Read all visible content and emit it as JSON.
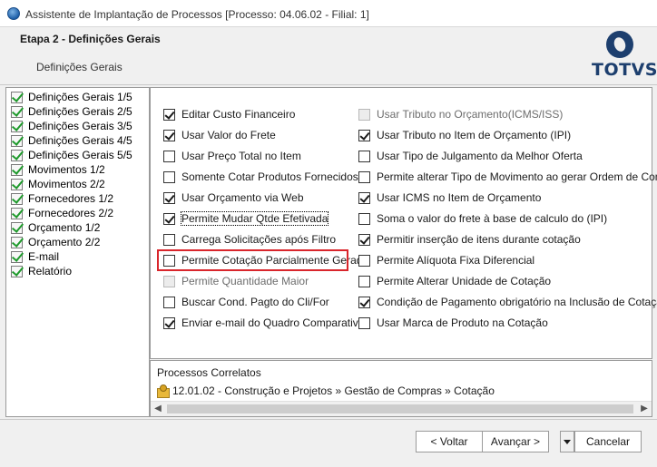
{
  "window": {
    "title": "Assistente de Implantação de Processos [Processo: 04.06.02 - Filial: 1]"
  },
  "header": {
    "step_title": "Etapa 2 - Definições Gerais",
    "step_subtitle": "Definições Gerais",
    "logo_text": "TOTVS",
    "logo_color": "#1d3f6e"
  },
  "sidebar": {
    "items": [
      {
        "label": "Definições Gerais 1/5",
        "icon": "green-check-icon"
      },
      {
        "label": "Definições Gerais 2/5",
        "icon": "green-check-icon"
      },
      {
        "label": "Definições Gerais 3/5",
        "icon": "green-check-icon"
      },
      {
        "label": "Definições Gerais 4/5",
        "icon": "green-check-icon"
      },
      {
        "label": "Definições Gerais 5/5",
        "icon": "green-check-icon"
      },
      {
        "label": "Movimentos 1/2",
        "icon": "green-check-icon"
      },
      {
        "label": "Movimentos 2/2",
        "icon": "green-check-icon"
      },
      {
        "label": "Fornecedores 1/2",
        "icon": "green-check-icon"
      },
      {
        "label": "Fornecedores 2/2",
        "icon": "green-check-icon"
      },
      {
        "label": "Orçamento 1/2",
        "icon": "green-check-icon"
      },
      {
        "label": "Orçamento 2/2",
        "icon": "green-check-icon"
      },
      {
        "label": "E-mail",
        "icon": "green-check-icon"
      },
      {
        "label": "Relatório",
        "icon": "green-check-icon"
      }
    ]
  },
  "options": {
    "left": [
      {
        "label": "Editar Custo Financeiro",
        "checked": true,
        "enabled": true
      },
      {
        "label": "Usar Valor do Frete",
        "checked": true,
        "enabled": true
      },
      {
        "label": "Usar  Preço Total no Item",
        "checked": false,
        "enabled": true
      },
      {
        "label": "Somente Cotar Produtos Fornecidos",
        "checked": false,
        "enabled": true
      },
      {
        "label": "Usar Orçamento via Web",
        "checked": true,
        "enabled": true
      },
      {
        "label": "Permite Mudar Qtde Efetivada",
        "checked": true,
        "enabled": true
      },
      {
        "label": "Carrega Solicitações após Filtro",
        "checked": false,
        "enabled": true
      },
      {
        "label": "Permite Cotação Parcialmente Gerada",
        "checked": false,
        "enabled": true
      },
      {
        "label": "Permite Quantidade Maior",
        "checked": false,
        "enabled": false
      },
      {
        "label": "Buscar Cond. Pagto do Cli/For",
        "checked": false,
        "enabled": true
      },
      {
        "label": "Enviar e-mail do Quadro Comparativo",
        "checked": true,
        "enabled": true
      }
    ],
    "right": [
      {
        "label": "Usar Tributo no Orçamento(ICMS/ISS)",
        "checked": false,
        "enabled": false
      },
      {
        "label": "Usar Tributo no Item de Orçamento (IPI)",
        "checked": true,
        "enabled": true
      },
      {
        "label": "Usar Tipo de Julgamento da Melhor Oferta",
        "checked": false,
        "enabled": true
      },
      {
        "label": "Permite alterar Tipo de Movimento ao gerar Ordem de Compra",
        "checked": false,
        "enabled": true
      },
      {
        "label": "Usar ICMS no Item de Orçamento",
        "checked": true,
        "enabled": true
      },
      {
        "label": "Soma o valor do frete à base de calculo do (IPI)",
        "checked": false,
        "enabled": true
      },
      {
        "label": "Permitir inserção de itens durante cotação",
        "checked": true,
        "enabled": true
      },
      {
        "label": "Permite Alíquota Fixa Diferencial",
        "checked": false,
        "enabled": true
      },
      {
        "label": "Permite Alterar Unidade de Cotação",
        "checked": false,
        "enabled": true
      },
      {
        "label": "Condição de Pagamento obrigatório na Inclusão de Cotação",
        "checked": true,
        "enabled": true
      },
      {
        "label": "Usar Marca de Produto na Cotação",
        "checked": false,
        "enabled": true
      }
    ],
    "highlight_color": "#d9262c"
  },
  "related": {
    "title": "Processos Correlatos",
    "item": "12.01.02 - Construção e Projetos » Gestão de Compras » Cotação",
    "icon": "folder-process-icon"
  },
  "buttons": {
    "back": "< Voltar",
    "next": "Avançar >",
    "cancel": "Cancelar"
  }
}
